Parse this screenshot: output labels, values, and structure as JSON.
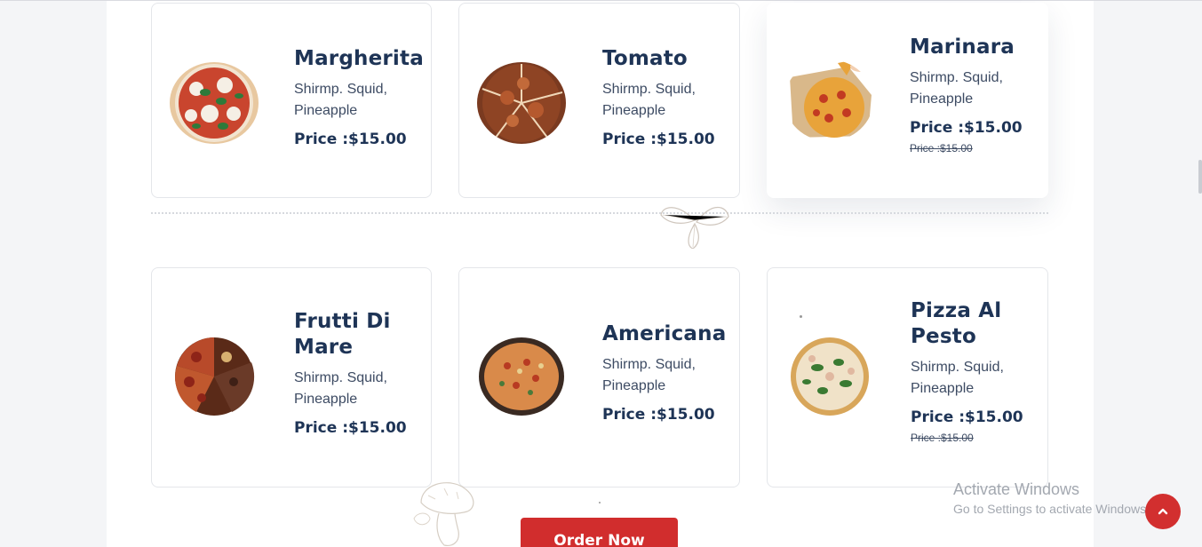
{
  "menu": {
    "price_prefix": "Price :",
    "items": [
      {
        "name": "Margherita",
        "desc": "Shirmp. Squid, Pineapple",
        "price": "Price :$15.00",
        "old_price": ""
      },
      {
        "name": "Tomato",
        "desc": "Shirmp. Squid, Pineapple",
        "price": "Price :$15.00",
        "old_price": ""
      },
      {
        "name": "Marinara",
        "desc": "Shirmp. Squid, Pineapple",
        "price": "Price :$15.00",
        "old_price": "Price :$15.00"
      },
      {
        "name": "Frutti Di Mare",
        "desc": "Shirmp. Squid, Pineapple",
        "price": "Price :$15.00",
        "old_price": ""
      },
      {
        "name": "Americana",
        "desc": "Shirmp. Squid, Pineapple",
        "price": "Price :$15.00",
        "old_price": ""
      },
      {
        "name": "Pizza Al Pesto",
        "desc": "Shirmp. Squid, Pineapple",
        "price": "Price :$15.00",
        "old_price": "Price :$15.00"
      }
    ]
  },
  "order_button": {
    "label": "Order Now"
  },
  "watermark": {
    "title": "Activate Windows",
    "subtitle": "Go to Settings to activate Windows."
  },
  "back_to_top": {
    "icon": "chevron-up-icon"
  },
  "colors": {
    "accent": "#d12d2d",
    "heading": "#1e3456",
    "text": "#3d4b63"
  }
}
